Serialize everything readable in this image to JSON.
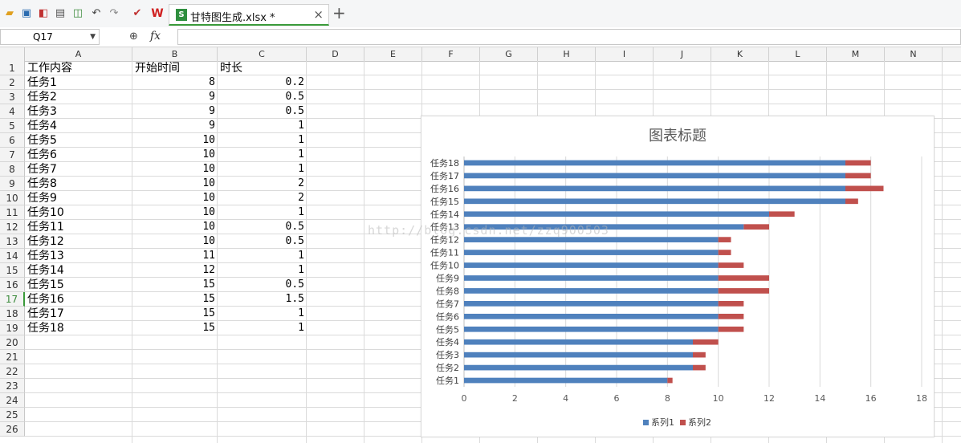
{
  "toolbar": {
    "tab_title": "甘特图生成.xlsx *",
    "tab_icon_label": "S",
    "close_glyph": "×",
    "add_glyph": "+",
    "icons": [
      "open-icon",
      "save-icon",
      "export-pdf-icon",
      "print-icon",
      "print-preview-icon",
      "undo-icon",
      "redo-icon",
      "format-painter-icon",
      "wps-logo-icon"
    ]
  },
  "formula_bar": {
    "name_box": "Q17",
    "fx_label": "fx",
    "zoom_glyph": "⊕",
    "formula": ""
  },
  "sheet": {
    "columns": [
      "A",
      "B",
      "C",
      "D",
      "E",
      "F",
      "G",
      "H",
      "I",
      "J",
      "K",
      "L",
      "M",
      "N"
    ],
    "rows": [
      "1",
      "2",
      "3",
      "4",
      "5",
      "6",
      "7",
      "8",
      "9",
      "10",
      "11",
      "12",
      "13",
      "14",
      "15",
      "16",
      "17",
      "18",
      "19",
      "20",
      "21",
      "22",
      "23",
      "24",
      "25",
      "26"
    ],
    "selected_row": "17",
    "header": [
      "工作内容",
      "开始时间",
      "时长"
    ],
    "data": [
      [
        "任务1",
        "8",
        "0.2"
      ],
      [
        "任务2",
        "9",
        "0.5"
      ],
      [
        "任务3",
        "9",
        "0.5"
      ],
      [
        "任务4",
        "9",
        "1"
      ],
      [
        "任务5",
        "10",
        "1"
      ],
      [
        "任务6",
        "10",
        "1"
      ],
      [
        "任务7",
        "10",
        "1"
      ],
      [
        "任务8",
        "10",
        "2"
      ],
      [
        "任务9",
        "10",
        "2"
      ],
      [
        "任务10",
        "10",
        "1"
      ],
      [
        "任务11",
        "10",
        "0.5"
      ],
      [
        "任务12",
        "10",
        "0.5"
      ],
      [
        "任务13",
        "11",
        "1"
      ],
      [
        "任务14",
        "12",
        "1"
      ],
      [
        "任务15",
        "15",
        "0.5"
      ],
      [
        "任务16",
        "15",
        "1.5"
      ],
      [
        "任务17",
        "15",
        "1"
      ],
      [
        "任务18",
        "15",
        "1"
      ]
    ]
  },
  "watermark": "http://blog.csdn.net/zzq900503",
  "chart_data": {
    "type": "bar",
    "orientation": "horizontal",
    "stacked": true,
    "title": "图表标题",
    "categories": [
      "任务1",
      "任务2",
      "任务3",
      "任务4",
      "任务5",
      "任务6",
      "任务7",
      "任务8",
      "任务9",
      "任务10",
      "任务11",
      "任务12",
      "任务13",
      "任务14",
      "任务15",
      "任务16",
      "任务17",
      "任务18"
    ],
    "series": [
      {
        "name": "系列1",
        "values": [
          8,
          9,
          9,
          9,
          10,
          10,
          10,
          10,
          10,
          10,
          10,
          10,
          11,
          12,
          15,
          15,
          15,
          15
        ],
        "color": "#4f81bd"
      },
      {
        "name": "系列2",
        "values": [
          0.2,
          0.5,
          0.5,
          1,
          1,
          1,
          1,
          2,
          2,
          1,
          0.5,
          0.5,
          1,
          1,
          0.5,
          1.5,
          1,
          1
        ],
        "color": "#c0504d"
      }
    ],
    "xlim": [
      0,
      18
    ],
    "xticks": [
      "0",
      "2",
      "4",
      "6",
      "8",
      "10",
      "12",
      "14",
      "16",
      "18"
    ],
    "grid": "vertical",
    "legend": "bottom"
  }
}
